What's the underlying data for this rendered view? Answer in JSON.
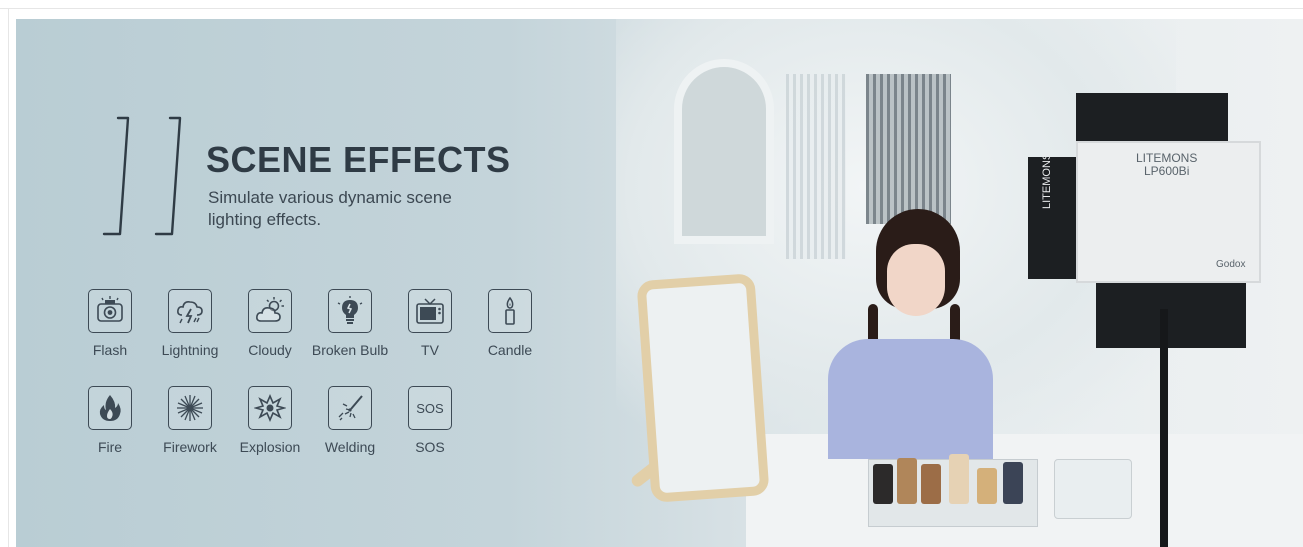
{
  "hero": {
    "number": "11",
    "title": "SCENE EFFECTS",
    "subtitle": "Simulate various dynamic scene lighting effects."
  },
  "effects": [
    {
      "label": "Flash",
      "icon": "flash-camera-icon"
    },
    {
      "label": "Lightning",
      "icon": "lightning-cloud-icon"
    },
    {
      "label": "Cloudy",
      "icon": "cloudy-sun-icon"
    },
    {
      "label": "Broken Bulb",
      "icon": "broken-bulb-icon"
    },
    {
      "label": "TV",
      "icon": "tv-icon"
    },
    {
      "label": "Candle",
      "icon": "candle-icon"
    },
    {
      "label": "Fire",
      "icon": "fire-icon"
    },
    {
      "label": "Firework",
      "icon": "firework-icon"
    },
    {
      "label": "Explosion",
      "icon": "explosion-icon"
    },
    {
      "label": "Welding",
      "icon": "welding-icon"
    },
    {
      "label": "SOS",
      "icon": "sos-icon"
    }
  ],
  "product": {
    "brand": "LITEMONS",
    "model": "LP600Bi",
    "maker": "Godox"
  },
  "colors": {
    "text": "#2f3b45",
    "icon": "#3d4a55",
    "bg_left": "#b9cdd4",
    "bg_right": "#eef1f2"
  }
}
